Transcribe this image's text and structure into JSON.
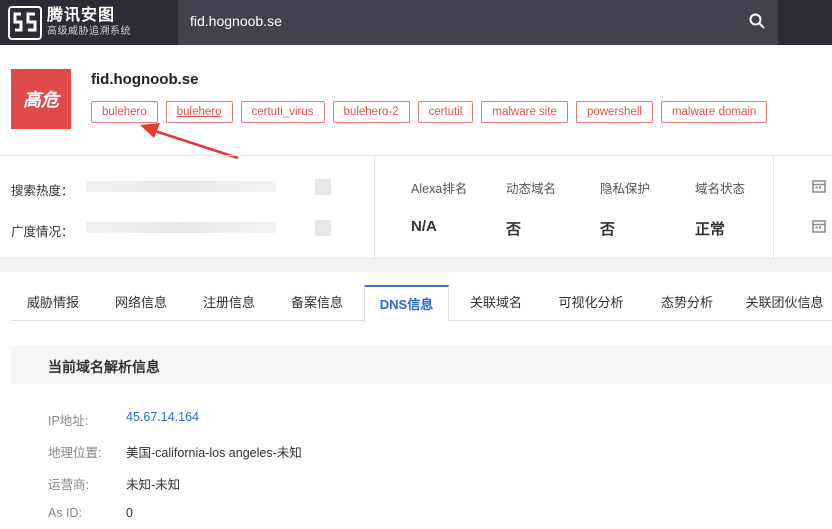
{
  "brand": {
    "name": "腾讯安图",
    "subtitle": "高级威胁追溯系统"
  },
  "search": {
    "query": "fid.hognoob.se"
  },
  "header": {
    "risk_level": "高危",
    "domain": "fid.hognoob.se",
    "tags": [
      "bulehero",
      "bulehero",
      "certuti_virus",
      "bulehero-2",
      "certutil",
      "malware site",
      "powershell",
      "malware domain"
    ]
  },
  "stats": {
    "search_heat_label": "搜索热度：",
    "breadth_label": "广度情况：",
    "columns": [
      {
        "label": "Alexa排名",
        "value": "N/A"
      },
      {
        "label": "动态域名",
        "value": "否"
      },
      {
        "label": "隐私保护",
        "value": "否"
      },
      {
        "label": "域名状态",
        "value": "正常"
      }
    ]
  },
  "tabs": [
    "威胁情报",
    "网络信息",
    "注册信息",
    "备案信息",
    "DNS信息",
    "关联域名",
    "可视化分析",
    "态势分析",
    "关联团伙信息"
  ],
  "active_tab": "DNS信息",
  "section": {
    "title": "当前域名解析信息",
    "rows": [
      {
        "label": "IP地址:",
        "value": "45.67.14.164"
      },
      {
        "label": "地理位置:",
        "value": "美国-california-los angeles-未知"
      },
      {
        "label": "运营商:",
        "value": "未知-未知"
      },
      {
        "label": "As ID:",
        "value": "0"
      }
    ]
  },
  "colors": {
    "risk": "#e04a4a",
    "accent": "#2d6cc9",
    "topbar": "#2c2c36",
    "tag_border": "#e57b7b"
  }
}
